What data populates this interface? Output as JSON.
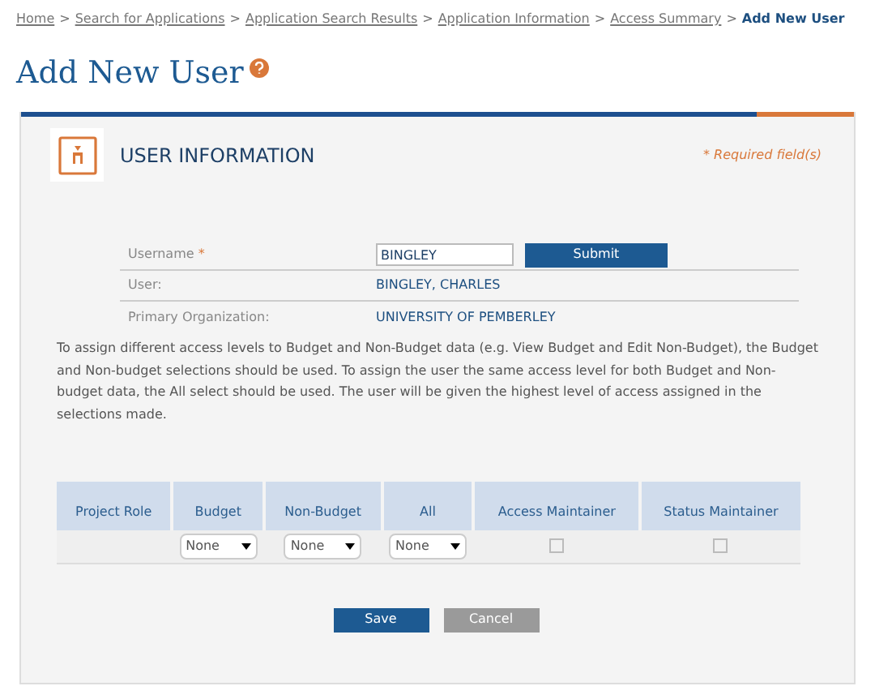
{
  "breadcrumb": {
    "links": [
      "Home",
      "Search for Applications",
      "Application Search Results",
      "Application Information",
      "Access Summary"
    ],
    "current": "Add New User",
    "separator": ">"
  },
  "page_title": "Add New User",
  "panel": {
    "title": "USER INFORMATION",
    "required_note": "* Required field(s)"
  },
  "form": {
    "username": {
      "label": "Username",
      "required_mark": "*",
      "value": "BINGLEY"
    },
    "submit": "Submit",
    "rows": [
      {
        "label": "User:",
        "value": "BINGLEY, CHARLES"
      },
      {
        "label": "Primary Organization:",
        "value": "UNIVERSITY OF PEMBERLEY"
      }
    ]
  },
  "instructions": "To assign different access levels to Budget and Non-Budget data (e.g. View Budget and Edit Non-Budget), the Budget and Non-budget selections should be used. To assign the user the same access level for both Budget and Non-budget data, the All select should be used. The user will be given the highest level of access assigned in the selections made.",
  "table": {
    "columns": [
      "Project Role",
      "Budget",
      "Non-Budget",
      "All",
      "Access Maintainer",
      "Status Maintainer"
    ],
    "row": [
      {
        "kind": "empty"
      },
      {
        "kind": "select",
        "value": "None"
      },
      {
        "kind": "select",
        "value": "None"
      },
      {
        "kind": "select",
        "value": "None"
      },
      {
        "kind": "checkbox",
        "checked": false
      },
      {
        "kind": "checkbox",
        "checked": false
      }
    ]
  },
  "buttons": [
    {
      "kind": "primary",
      "label": "Save"
    },
    {
      "kind": "secondary",
      "label": "Cancel"
    }
  ]
}
